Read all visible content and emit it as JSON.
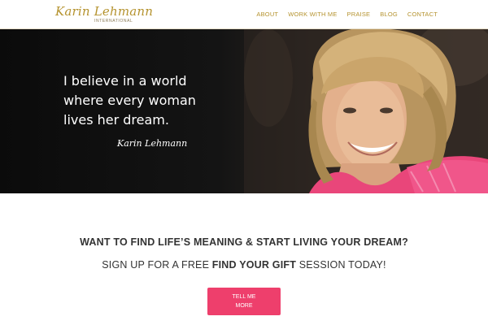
{
  "header": {
    "logo": {
      "script_text": "Karin Lehmann",
      "sub_text": "INTERNATIONAL"
    },
    "nav": [
      {
        "label": "ABOUT"
      },
      {
        "label": "WORK WITH ME"
      },
      {
        "label": "PRAISE"
      },
      {
        "label": "BLOG"
      },
      {
        "label": "CONTACT"
      }
    ]
  },
  "hero": {
    "quote_lines": [
      "I believe in a world",
      "where every woman",
      "lives her dream."
    ],
    "signature": "Karin Lehmann"
  },
  "cta": {
    "heading": "WANT TO FIND LIFE’S MEANING & START LIVING YOUR DREAM?",
    "sub_prefix": "SIGN UP FOR A FREE ",
    "sub_bold": "FIND YOUR GIFT",
    "sub_suffix": " SESSION TODAY!",
    "button_label": "TELL ME MORE"
  },
  "colors": {
    "accent_gold": "#b5932f",
    "button_pink": "#ee3f6c",
    "text_dark": "#333333"
  }
}
